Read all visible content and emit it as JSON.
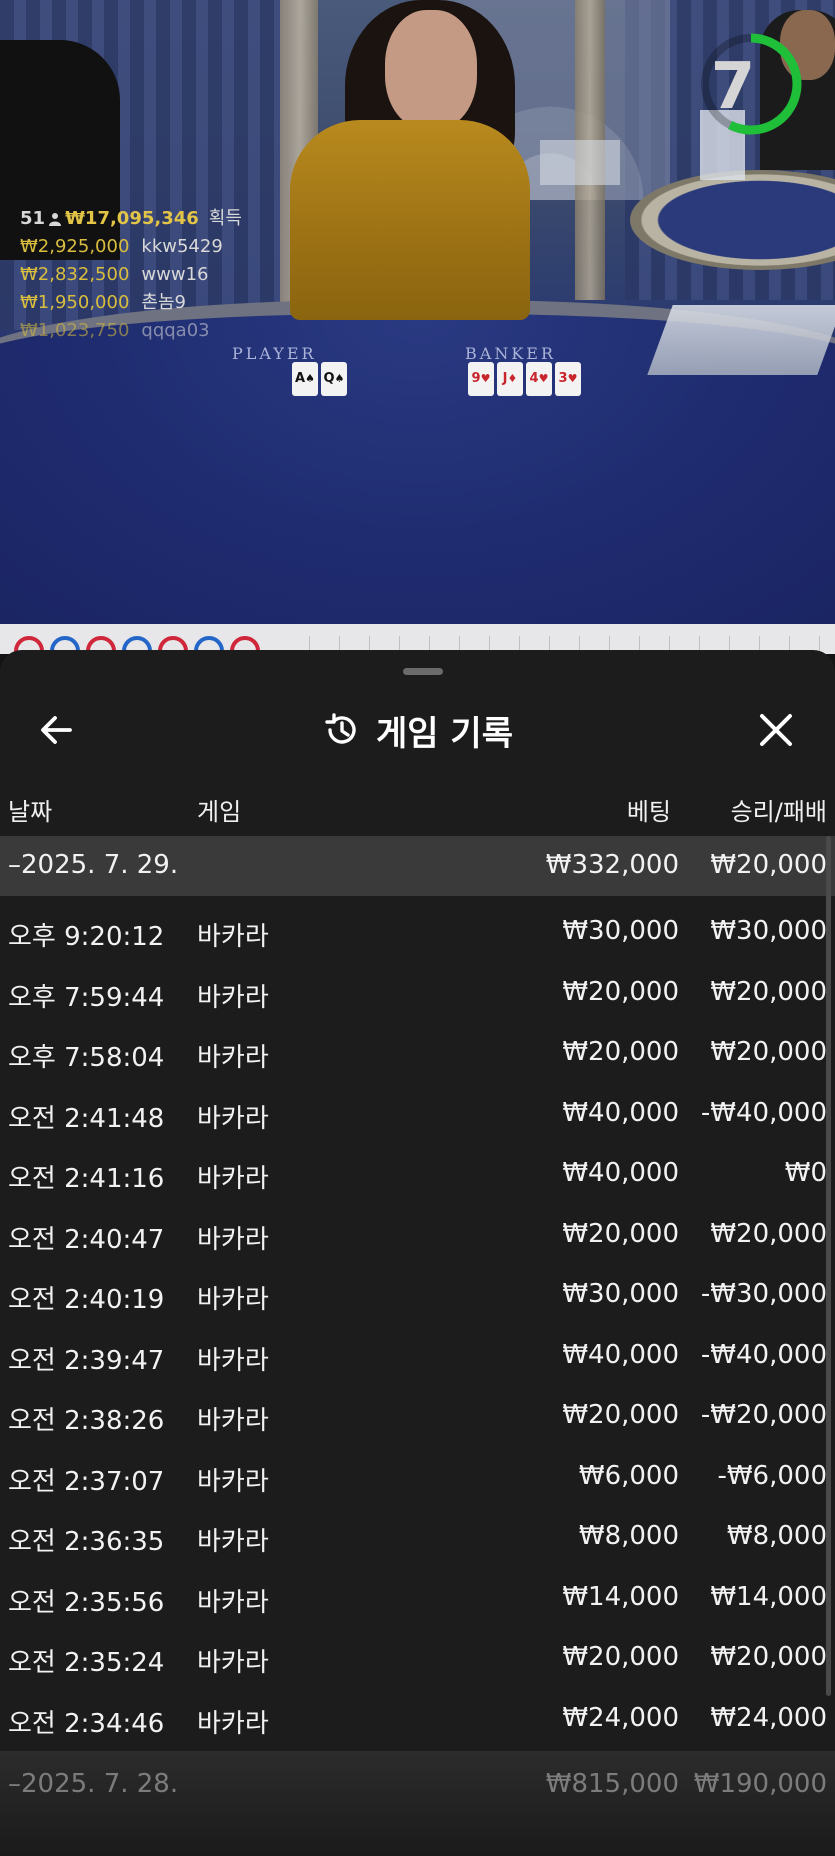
{
  "video": {
    "timer": "7",
    "timer_color": "#1fbf3a",
    "table_labels": {
      "player": "PLAYER",
      "banker": "BANKER"
    },
    "player_cards": [
      {
        "rank": "A",
        "suit": "♠",
        "color": "black"
      },
      {
        "rank": "Q",
        "suit": "♠",
        "color": "black"
      }
    ],
    "banker_cards": [
      {
        "rank": "9",
        "suit": "♥",
        "color": "red"
      },
      {
        "rank": "J",
        "suit": "♦",
        "color": "red"
      },
      {
        "rank": "4",
        "suit": "♥",
        "color": "red"
      },
      {
        "rank": "3",
        "suit": "♥",
        "color": "red"
      }
    ],
    "winners": {
      "count": "51",
      "total": "₩17,095,346",
      "label": "획득",
      "list": [
        {
          "amount": "₩2,925,000",
          "name": "kkw5429"
        },
        {
          "amount": "₩2,832,500",
          "name": "www16"
        },
        {
          "amount": "₩1,950,000",
          "name": "촌놈9"
        },
        {
          "amount": "₩1,023,750",
          "name": "qqqa03"
        }
      ]
    }
  },
  "sheet": {
    "title": "게임 기록",
    "back_icon": "arrow-left-icon",
    "close_icon": "close-icon",
    "history_icon": "history-icon",
    "columns": {
      "date": "날짜",
      "game": "게임",
      "bet": "베팅",
      "result": "승리/패배"
    },
    "days": [
      {
        "date": "–2025. 7. 29.",
        "bet_total": "₩332,000",
        "result_total": "₩20,000",
        "transactions": [
          {
            "time": "오후 9:20:12",
            "game": "바카라",
            "bet": "₩30,000",
            "result": "₩30,000"
          },
          {
            "time": "오후 7:59:44",
            "game": "바카라",
            "bet": "₩20,000",
            "result": "₩20,000"
          },
          {
            "time": "오후 7:58:04",
            "game": "바카라",
            "bet": "₩20,000",
            "result": "₩20,000"
          },
          {
            "time": "오전 2:41:48",
            "game": "바카라",
            "bet": "₩40,000",
            "result": "-₩40,000"
          },
          {
            "time": "오전 2:41:16",
            "game": "바카라",
            "bet": "₩40,000",
            "result": "₩0"
          },
          {
            "time": "오전 2:40:47",
            "game": "바카라",
            "bet": "₩20,000",
            "result": "₩20,000"
          },
          {
            "time": "오전 2:40:19",
            "game": "바카라",
            "bet": "₩30,000",
            "result": "-₩30,000"
          },
          {
            "time": "오전 2:39:47",
            "game": "바카라",
            "bet": "₩40,000",
            "result": "-₩40,000"
          },
          {
            "time": "오전 2:38:26",
            "game": "바카라",
            "bet": "₩20,000",
            "result": "-₩20,000"
          },
          {
            "time": "오전 2:37:07",
            "game": "바카라",
            "bet": "₩6,000",
            "result": "-₩6,000"
          },
          {
            "time": "오전 2:36:35",
            "game": "바카라",
            "bet": "₩8,000",
            "result": "₩8,000"
          },
          {
            "time": "오전 2:35:56",
            "game": "바카라",
            "bet": "₩14,000",
            "result": "₩14,000"
          },
          {
            "time": "오전 2:35:24",
            "game": "바카라",
            "bet": "₩20,000",
            "result": "₩20,000"
          },
          {
            "time": "오전 2:34:46",
            "game": "바카라",
            "bet": "₩24,000",
            "result": "₩24,000"
          }
        ]
      },
      {
        "date": "–2025. 7. 28.",
        "bet_total": "₩815,000",
        "result_total": "₩190,000",
        "transactions": []
      }
    ]
  }
}
